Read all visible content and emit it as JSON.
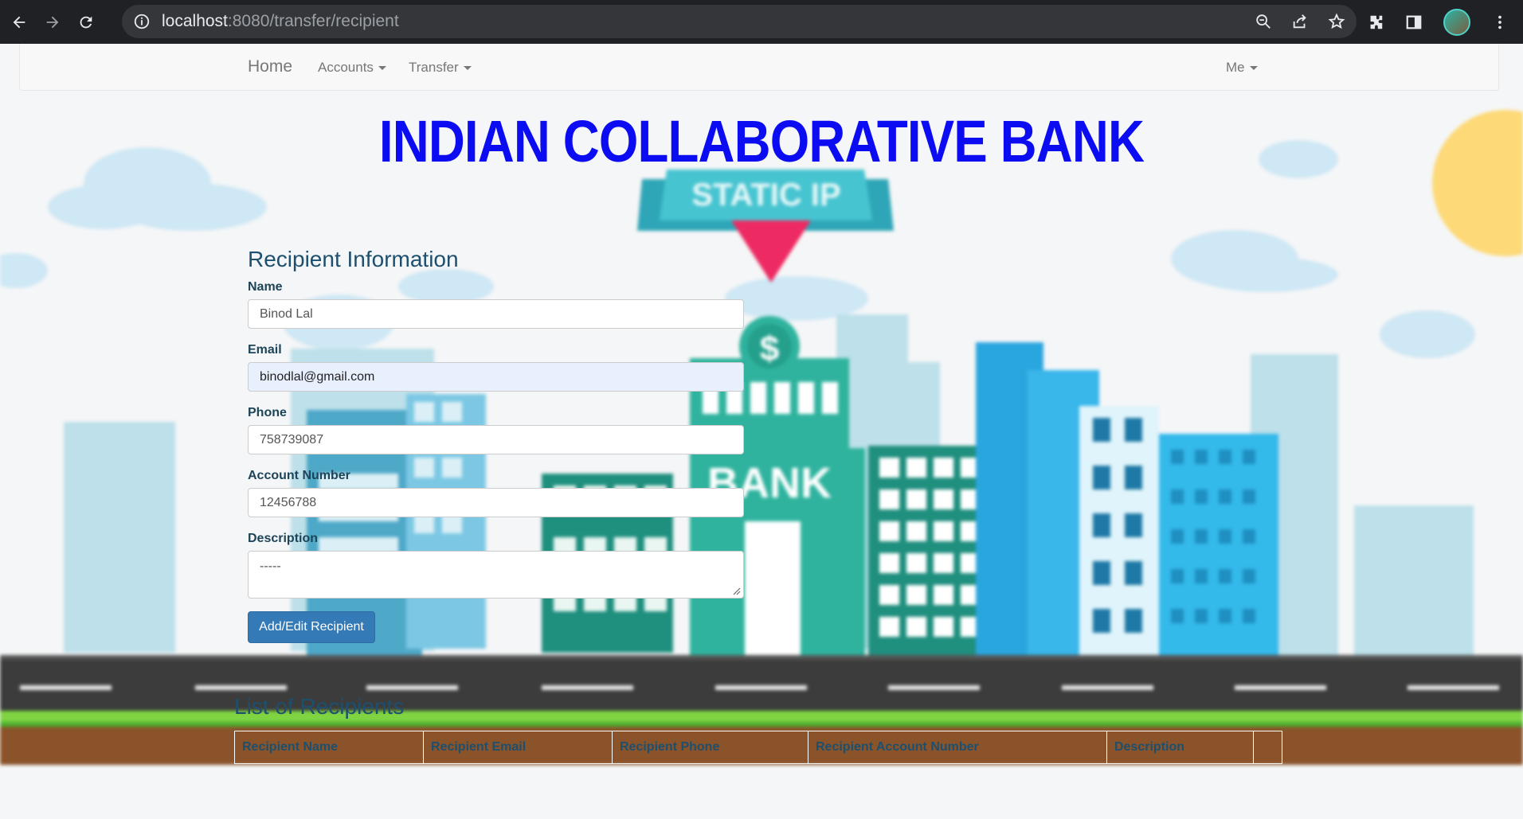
{
  "browser": {
    "url_host": "localhost",
    "url_rest": ":8080/transfer/recipient"
  },
  "navbar": {
    "home": "Home",
    "accounts": "Accounts",
    "transfer": "Transfer",
    "me": "Me"
  },
  "banner": {
    "title": "INDIAN COLLABORATIVE BANK",
    "sign_text": "STATIC IP",
    "building_text": "BANK"
  },
  "form": {
    "title": "Recipient Information",
    "name_label": "Name",
    "name_value": "Binod Lal",
    "email_label": "Email",
    "email_value": "binodlal@gmail.com",
    "phone_label": "Phone",
    "phone_value": "758739087",
    "account_label": "Account Number",
    "account_value": "12456788",
    "description_label": "Description",
    "description_value": "-----",
    "submit_label": "Add/Edit Recipient"
  },
  "list": {
    "title": "List of Recipients",
    "columns": [
      "Recipient Name",
      "Recipient Email",
      "Recipient Phone",
      "Recipient Account Number",
      "Description",
      ""
    ]
  },
  "colors": {
    "title_blue": "#0c0cf2",
    "button_blue": "#337ab7",
    "heading_teal": "#1d4f6e"
  }
}
